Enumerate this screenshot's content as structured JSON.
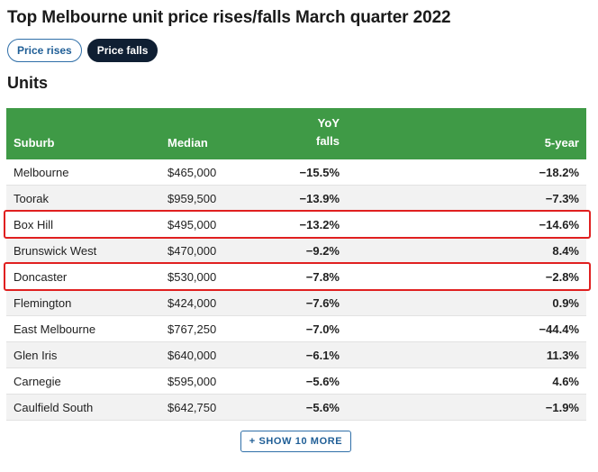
{
  "title": "Top Melbourne unit price rises/falls March quarter 2022",
  "tabs": [
    {
      "label": "Price rises",
      "active": false
    },
    {
      "label": "Price falls",
      "active": true
    }
  ],
  "section_title": "Units",
  "table": {
    "headers": {
      "suburb": "Suburb",
      "median": "Median",
      "yoy_line1": "YoY",
      "yoy_line2": "falls",
      "five_year": "5-year"
    },
    "rows": [
      {
        "suburb": "Melbourne",
        "median": "$465,000",
        "yoy": "−15.5%",
        "five_year": "−18.2%",
        "highlighted": false
      },
      {
        "suburb": "Toorak",
        "median": "$959,500",
        "yoy": "−13.9%",
        "five_year": "−7.3%",
        "highlighted": false
      },
      {
        "suburb": "Box Hill",
        "median": "$495,000",
        "yoy": "−13.2%",
        "five_year": "−14.6%",
        "highlighted": true
      },
      {
        "suburb": "Brunswick West",
        "median": "$470,000",
        "yoy": "−9.2%",
        "five_year": "8.4%",
        "highlighted": false
      },
      {
        "suburb": "Doncaster",
        "median": "$530,000",
        "yoy": "−7.8%",
        "five_year": "−2.8%",
        "highlighted": true
      },
      {
        "suburb": "Flemington",
        "median": "$424,000",
        "yoy": "−7.6%",
        "five_year": "0.9%",
        "highlighted": false
      },
      {
        "suburb": "East Melbourne",
        "median": "$767,250",
        "yoy": "−7.0%",
        "five_year": "−44.4%",
        "highlighted": false
      },
      {
        "suburb": "Glen Iris",
        "median": "$640,000",
        "yoy": "−6.1%",
        "five_year": "11.3%",
        "highlighted": false
      },
      {
        "suburb": "Carnegie",
        "median": "$595,000",
        "yoy": "−5.6%",
        "five_year": "4.6%",
        "highlighted": false
      },
      {
        "suburb": "Caulfield South",
        "median": "$642,750",
        "yoy": "−5.6%",
        "five_year": "−1.9%",
        "highlighted": false
      }
    ]
  },
  "show_more_label": "+ SHOW 10 MORE",
  "colors": {
    "header_green": "#3f9a46",
    "active_tab": "#0f1f33",
    "accent_blue": "#2f6fa8",
    "highlight_red": "#e02020"
  }
}
